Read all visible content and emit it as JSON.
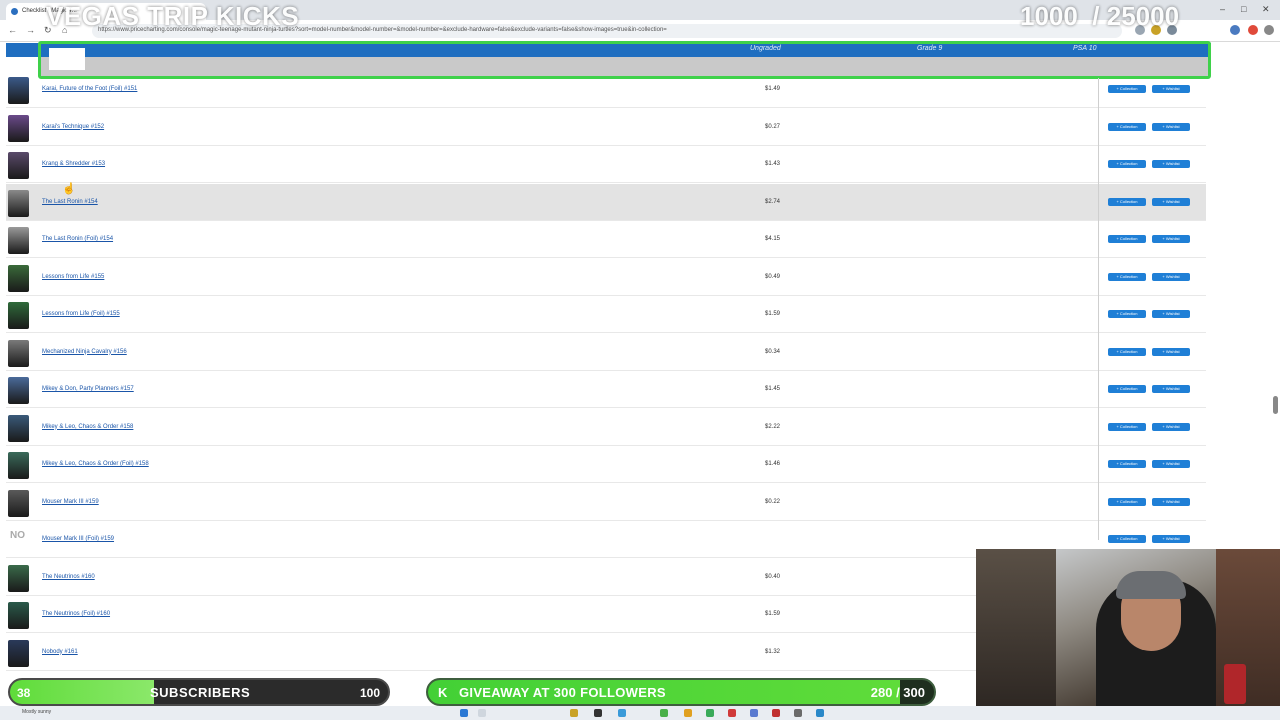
{
  "browser": {
    "tab_title": "Checklist | Magic T...",
    "url": "https://www.pricecharting.com/console/magic-teenage-mutant-ninja-turtles?sort=model-number&model-number=&model-number=&exclude-hardware=false&exclude-variants=false&show-images=true&in-collection=",
    "controls": [
      "–",
      "□",
      "✕"
    ]
  },
  "overlay": {
    "title": "VEGAS TRIP KICKS",
    "count": "1000  / 25000"
  },
  "table": {
    "headers": {
      "ungraded": "Ungraded",
      "grade9": "Grade 9",
      "psa10": "PSA 10"
    },
    "button_collection": "+ Collection",
    "button_wishlist": "+ Wishlist",
    "rows": [
      {
        "name": "Karai, Future of the Foot (Foil) #151",
        "price": "$1.49",
        "thumb": "#3b5a8a"
      },
      {
        "name": "Karai's Technique #152",
        "price": "$0.27",
        "thumb": "#6a4a8a"
      },
      {
        "name": "Krang & Shredder #153",
        "price": "$1.43",
        "thumb": "#5a4a6a"
      },
      {
        "name": "The Last Ronin #154",
        "price": "$2.74",
        "thumb": "#8a8a8a"
      },
      {
        "name": "The Last Ronin (Foil) #154",
        "price": "$4.15",
        "thumb": "#9a9a9a"
      },
      {
        "name": "Lessons from Life #155",
        "price": "$0.49",
        "thumb": "#3a6a3a"
      },
      {
        "name": "Lessons from Life (Foil) #155",
        "price": "$1.59",
        "thumb": "#2f6a3a"
      },
      {
        "name": "Mechanized Ninja Cavalry #156",
        "price": "$0.34",
        "thumb": "#7a7a7a"
      },
      {
        "name": "Mikey & Don, Party Planners #157",
        "price": "$1.45",
        "thumb": "#4a6a9a"
      },
      {
        "name": "Mikey & Leo, Chaos & Order #158",
        "price": "$2.22",
        "thumb": "#3a5a7a"
      },
      {
        "name": "Mikey & Leo, Chaos & Order (Foil) #158",
        "price": "$1.46",
        "thumb": "#3a6a5a"
      },
      {
        "name": "Mouser Mark III #159",
        "price": "$0.22",
        "thumb": "#5a5a5a"
      },
      {
        "name": "Mouser Mark III (Foil) #159",
        "price": "",
        "thumb": ""
      },
      {
        "name": "The Neutrinos #160",
        "price": "$0.40",
        "thumb": "#3a6a4a"
      },
      {
        "name": "The Neutrinos (Foil) #160",
        "price": "$1.59",
        "thumb": "#2a5a4a"
      },
      {
        "name": "Nobody #161",
        "price": "$1.32",
        "thumb": "#2a3a5a"
      }
    ],
    "no_image_text": "NO"
  },
  "subscribers": {
    "current": "38",
    "label": "SUBSCRIBERS",
    "goal": "100",
    "progress": 0.38
  },
  "giveaway": {
    "icon": "K",
    "label": "GIVEAWAY AT 300 FOLLOWERS",
    "count": "280 / 300",
    "progress": 0.933
  },
  "taskbar": {
    "weather": "Mostly sunny"
  },
  "colors": {
    "header_blue": "#1f6ec0",
    "button_blue": "#1f7fd6",
    "link_blue": "#1a55a8",
    "highlight_green": "#3fd14a",
    "bar_green": "#5fdc3a"
  }
}
